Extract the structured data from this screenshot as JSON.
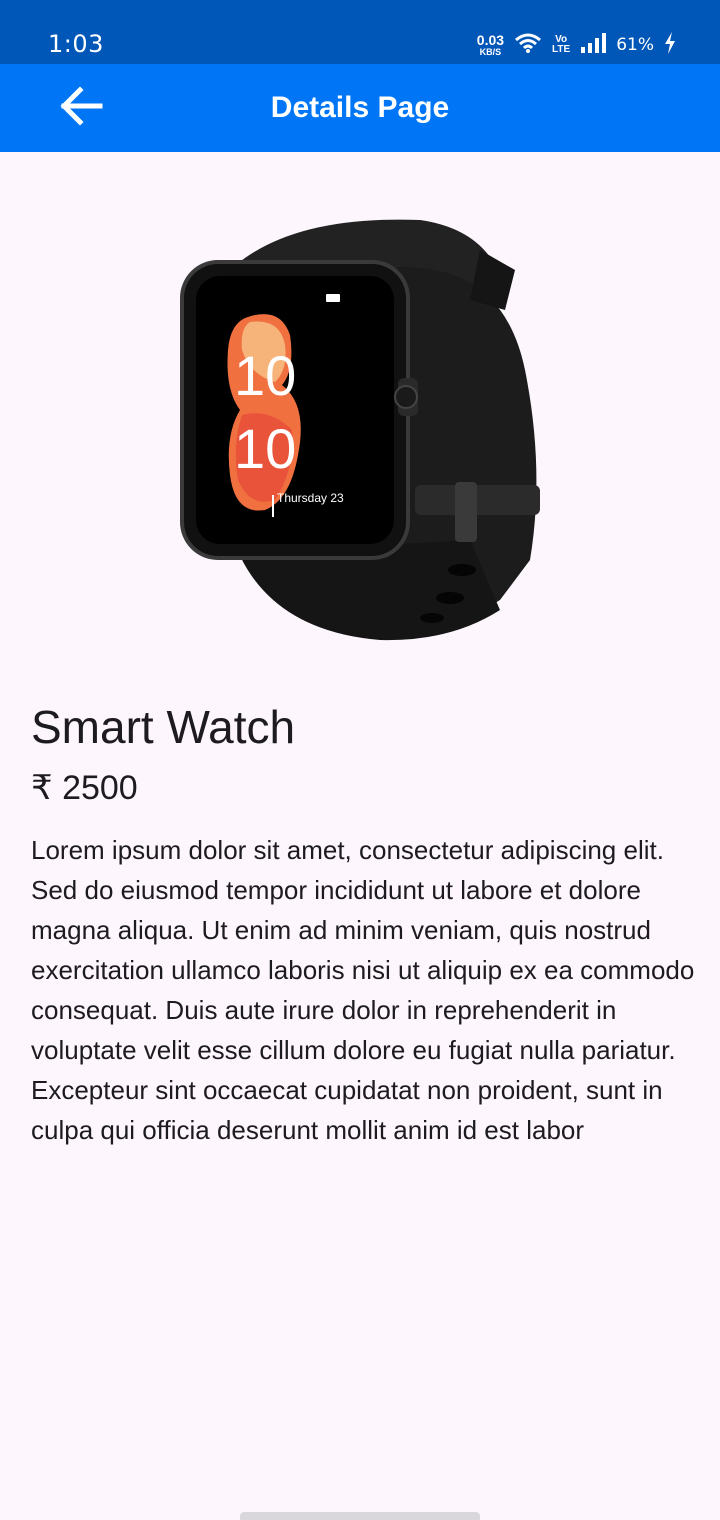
{
  "status_bar": {
    "time": "1:03",
    "net_speed_value": "0.03",
    "net_speed_unit": "KB/S",
    "volte_top": "Vo",
    "volte_bottom": "LTE",
    "battery": "61%"
  },
  "app_bar": {
    "title": "Details Page",
    "back_icon": "arrow-back-icon"
  },
  "product": {
    "image_icon": "smart-watch-image",
    "watch_face_hour": "10",
    "watch_face_minute": "10",
    "watch_face_date": "Thursday 23",
    "name": "Smart Watch",
    "price": "₹ 2500",
    "description": "Lorem ipsum dolor sit amet, consectetur adipiscing elit. Sed do eiusmod tempor incididunt ut labore et dolore magna aliqua. Ut enim ad minim veniam, quis nostrud exercitation ullamco laboris nisi ut aliquip ex ea commodo consequat. Duis aute irure dolor in reprehenderit in voluptate velit esse cillum dolore eu fugiat nulla pariatur. Excepteur sint occaecat cupidatat non proident, sunt in culpa qui officia deserunt mollit anim id est labor"
  },
  "colors": {
    "status_bar": "#0057b8",
    "app_bar": "#0076f6",
    "background": "#fdf7fd",
    "text": "#1d1b20"
  }
}
